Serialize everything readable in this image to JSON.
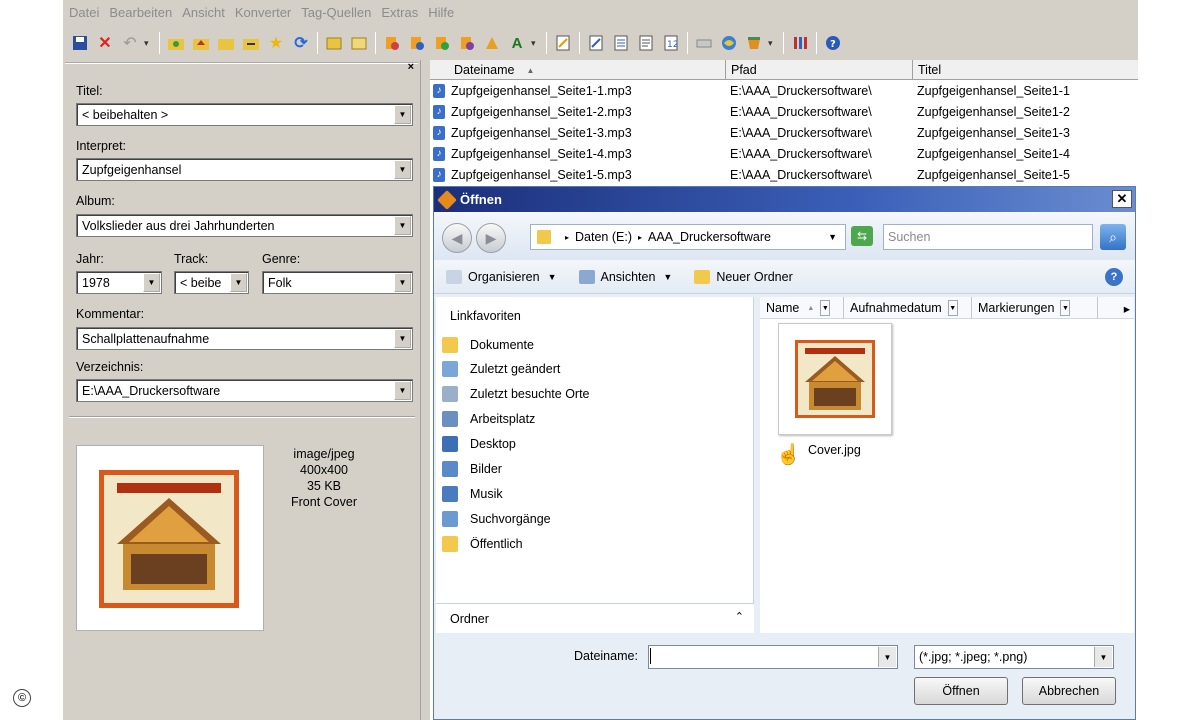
{
  "app": {
    "menu": [
      "Datei",
      "Bearbeiten",
      "Ansicht",
      "Konverter",
      "Tag-Quellen",
      "Extras",
      "Hilfe"
    ],
    "tag_panel": {
      "close": "×",
      "titel_label": "Titel:",
      "titel_value": "< beibehalten >",
      "interpret_label": "Interpret:",
      "interpret_value": "Zupfgeigenhansel",
      "album_label": "Album:",
      "album_value": "Volkslieder aus drei Jahrhunderten",
      "jahr_label": "Jahr:",
      "jahr_value": "1978",
      "track_label": "Track:",
      "track_value": "< beibe",
      "genre_label": "Genre:",
      "genre_value": "Folk",
      "kommentar_label": "Kommentar:",
      "kommentar_value": "Schallplattenaufnahme",
      "verzeichnis_label": "Verzeichnis:",
      "verzeichnis_value": "E:\\AAA_Druckersoftware",
      "cover_info": [
        "image/jpeg",
        "400x400",
        "35 KB",
        "Front Cover"
      ]
    },
    "file_list": {
      "columns": [
        "Dateiname",
        "Pfad",
        "Titel"
      ],
      "rows": [
        [
          "Zupfgeigenhansel_Seite1-1.mp3",
          "E:\\AAA_Druckersoftware\\",
          "Zupfgeigenhansel_Seite1-1"
        ],
        [
          "Zupfgeigenhansel_Seite1-2.mp3",
          "E:\\AAA_Druckersoftware\\",
          "Zupfgeigenhansel_Seite1-2"
        ],
        [
          "Zupfgeigenhansel_Seite1-3.mp3",
          "E:\\AAA_Druckersoftware\\",
          "Zupfgeigenhansel_Seite1-3"
        ],
        [
          "Zupfgeigenhansel_Seite1-4.mp3",
          "E:\\AAA_Druckersoftware\\",
          "Zupfgeigenhansel_Seite1-4"
        ],
        [
          "Zupfgeigenhansel_Seite1-5.mp3",
          "E:\\AAA_Druckersoftware\\",
          "Zupfgeigenhansel_Seite1-5"
        ]
      ]
    }
  },
  "dialog": {
    "title": "Öffnen",
    "close": "✕",
    "breadcrumb": [
      "Daten (E:)",
      "AAA_Druckersoftware"
    ],
    "search_placeholder": "Suchen",
    "commands": [
      "Organisieren",
      "Ansichten",
      "Neuer Ordner"
    ],
    "help": "?",
    "favorites_title": "Linkfavoriten",
    "favorites": [
      {
        "label": "Dokumente",
        "icon": "folder-icon",
        "color": "#f2c94c"
      },
      {
        "label": "Zuletzt geändert",
        "icon": "recent-icon",
        "color": "#7aa6d8"
      },
      {
        "label": "Zuletzt besuchte Orte",
        "icon": "places-icon",
        "color": "#9ab0c8"
      },
      {
        "label": "Arbeitsplatz",
        "icon": "computer-icon",
        "color": "#6a8fc0"
      },
      {
        "label": "Desktop",
        "icon": "desktop-icon",
        "color": "#3c6fb8"
      },
      {
        "label": "Bilder",
        "icon": "pictures-icon",
        "color": "#5a8ac8"
      },
      {
        "label": "Musik",
        "icon": "music-icon",
        "color": "#4a7ac0"
      },
      {
        "label": "Suchvorgänge",
        "icon": "search-folder-icon",
        "color": "#6a9ad0"
      },
      {
        "label": "Öffentlich",
        "icon": "folder-icon",
        "color": "#f2c94c"
      }
    ],
    "folder_label": "Ordner",
    "file_columns": [
      "Name",
      "Aufnahmedatum",
      "Markierungen"
    ],
    "file_name": "Cover.jpg",
    "filename_label": "Dateiname:",
    "filename_value": "",
    "filetype_value": "(*.jpg; *.jpeg; *.png)",
    "open_button": "Öffnen",
    "cancel_button": "Abbrechen"
  }
}
